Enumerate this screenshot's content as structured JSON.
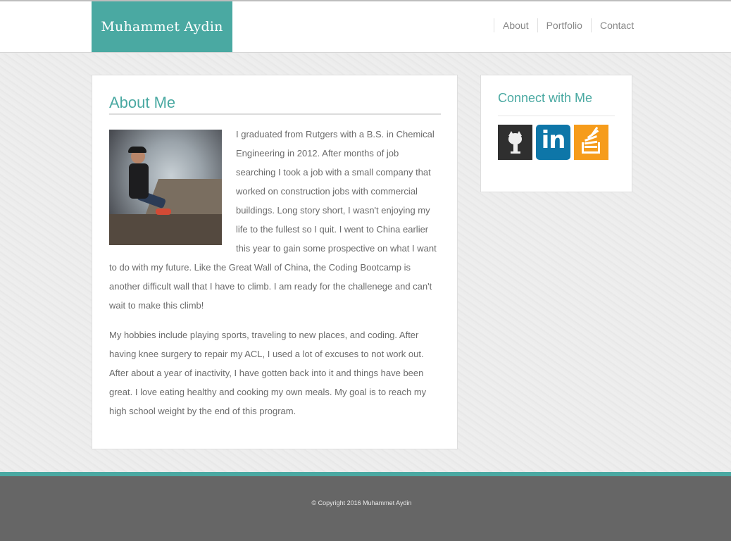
{
  "header": {
    "brand": "Muhammet Aydin",
    "nav": [
      {
        "label": "About"
      },
      {
        "label": "Portfolio"
      },
      {
        "label": "Contact"
      }
    ]
  },
  "about": {
    "title": "About Me",
    "paragraph1": "I graduated from Rutgers with a B.S. in Chemical Engineering in 2012. After months of job searching I took a job with a small company that worked on construction jobs with commercial buildings. Long story short, I wasn't enjoying my life to the fullest so I quit. I went to China earlier this year to gain some prospective on what I want to do with my future. Like the Great Wall of China, the Coding Bootcamp is another difficult wall that I have to climb. I am ready for the challenege and can't wait to make this climb!",
    "paragraph2": "My hobbies include playing sports, traveling to new places, and coding. After having knee surgery to repair my ACL, I used a lot of excuses to not work out. After about a year of inactivity, I have gotten back into it and things have been great. I love eating healthy and cooking my own meals. My goal is to reach my high school weight by the end of this program."
  },
  "connect": {
    "title": "Connect with Me",
    "links": [
      {
        "icon": "github-icon",
        "color": "#2f2f2f"
      },
      {
        "icon": "linkedin-icon",
        "text": "in",
        "color": "#0e76a8"
      },
      {
        "icon": "stackoverflow-icon",
        "color": "#f69c1b"
      }
    ]
  },
  "footer": {
    "copyright": "© Copyright 2016 Muhammet Aydin"
  },
  "colors": {
    "accent": "#4aa9a2",
    "footer": "#666666"
  }
}
